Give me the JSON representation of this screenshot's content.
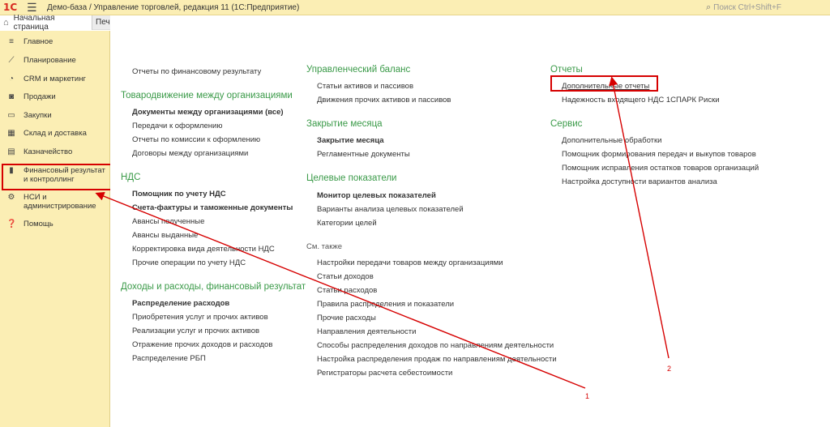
{
  "titlebar": {
    "logo": "1С",
    "title": "Демо-база / Управление торговлей, редакция 11  (1С:Предприятие)",
    "search_placeholder": "Поиск Ctrl+Shift+F"
  },
  "tabs": {
    "home": "Начальная страница",
    "second": "Печ"
  },
  "sidebar": {
    "items": [
      {
        "label": "Главное",
        "icon": "menu-lines-icon"
      },
      {
        "label": "Планирование",
        "icon": "chart-line-icon"
      },
      {
        "label": "CRM и маркетинг",
        "icon": "pie-chart-icon"
      },
      {
        "label": "Продажи",
        "icon": "shopping-bag-icon"
      },
      {
        "label": "Закупки",
        "icon": "cart-icon"
      },
      {
        "label": "Склад и доставка",
        "icon": "warehouse-icon"
      },
      {
        "label": "Казначейство",
        "icon": "treasury-icon"
      },
      {
        "label": "Финансовый результат и контроллинг",
        "icon": "bar-chart-icon"
      },
      {
        "label": "НСИ и администрирование",
        "icon": "gear-icon"
      },
      {
        "label": "Помощь",
        "icon": "help-icon"
      }
    ]
  },
  "col1": {
    "top_link": "Отчеты по финансовому результату",
    "g1_title": "Товародвижение между организациями",
    "g1_items": [
      "Документы между организациями (все)",
      "Передачи к оформлению",
      "Отчеты по комиссии к оформлению",
      "Договоры между организациями"
    ],
    "g2_title": "НДС",
    "g2_items": [
      "Помощник по учету НДС",
      "Счета-фактуры и таможенные документы",
      "Авансы полученные",
      "Авансы выданные",
      "Корректировка вида деятельности НДС",
      "Прочие операции по учету НДС"
    ],
    "g3_title": "Доходы и расходы, финансовый результат",
    "g3_items": [
      "Распределение расходов",
      "Приобретения услуг и прочих активов",
      "Реализации услуг и прочих активов",
      "Отражение прочих доходов и расходов",
      "Распределение РБП"
    ]
  },
  "col2": {
    "g1_title": "Управленческий баланс",
    "g1_items": [
      "Статьи активов и пассивов",
      "Движения прочих активов и пассивов"
    ],
    "g2_title": "Закрытие месяца",
    "g2_items": [
      "Закрытие месяца",
      "Регламентные документы"
    ],
    "g3_title": "Целевые показатели",
    "g3_items": [
      "Монитор целевых показателей",
      "Варианты анализа целевых показателей",
      "Категории целей"
    ],
    "see_also": "См. также",
    "see_items": [
      "Настройки передачи товаров между организациями",
      "Статьи доходов",
      "Статьи расходов",
      "Правила распределения и показатели",
      "Прочие расходы",
      "Направления деятельности",
      "Способы распределения доходов по направлениям деятельности",
      "Настройка распределения продаж по направлениям деятельности",
      "Регистраторы расчета себестоимости"
    ]
  },
  "col3": {
    "g1_title": "Отчеты",
    "g1_items": [
      "Дополнительные отчеты",
      "Надежность входящего НДС 1СПАРК Риски"
    ],
    "g2_title": "Сервис",
    "g2_items": [
      "Дополнительные обработки",
      "Помощник формирования передач и выкупов товаров",
      "Помощник исправления остатков товаров организаций",
      "Настройка доступности вариантов анализа"
    ]
  },
  "annotations": {
    "n1": "1",
    "n2": "2",
    "color": "#d60000"
  }
}
